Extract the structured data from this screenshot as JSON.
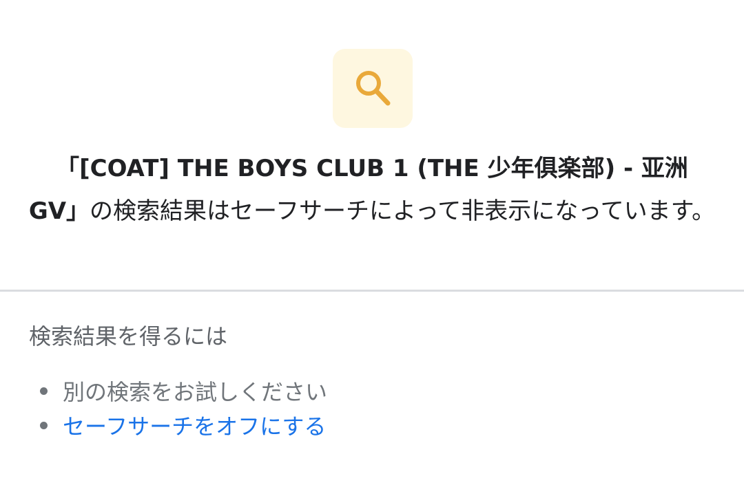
{
  "icon": {
    "name": "search-icon",
    "color": "#e9a93a",
    "background": "#fef7e0"
  },
  "message": {
    "open_quote": "「",
    "query": "[COAT] THE BOYS CLUB 1 (THE 少年俱楽部) - 亚洲GV",
    "close_quote": "」",
    "suffix": "の検索結果はセーフサーチによって非表示になっています。"
  },
  "help": {
    "heading": "検索結果を得るには",
    "suggestions": [
      {
        "label": "別の検索をお試しください",
        "is_link": false
      },
      {
        "label": "セーフサーチをオフにする",
        "is_link": true,
        "color": "#1a73e8"
      }
    ]
  }
}
